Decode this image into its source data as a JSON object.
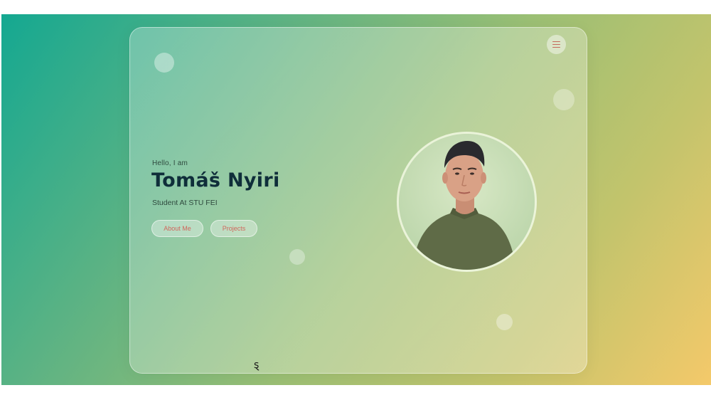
{
  "hero": {
    "greeting": "Hello, I am",
    "name": "Tomáš Nyiri",
    "subtitle": "Student At STU FEI"
  },
  "buttons": {
    "about_label": "About Me",
    "projects_label": "Projects"
  },
  "menu": {
    "icon": "hamburger-menu-icon"
  },
  "avatar": {
    "alt": "Profile photo of Tomáš Nyiri"
  },
  "cursor": {
    "glyph": "ȿ"
  },
  "colors": {
    "accent": "#d0675c",
    "title": "#0f2e3a",
    "gradient_start": "#14a891",
    "gradient_end": "#f4c96a"
  }
}
